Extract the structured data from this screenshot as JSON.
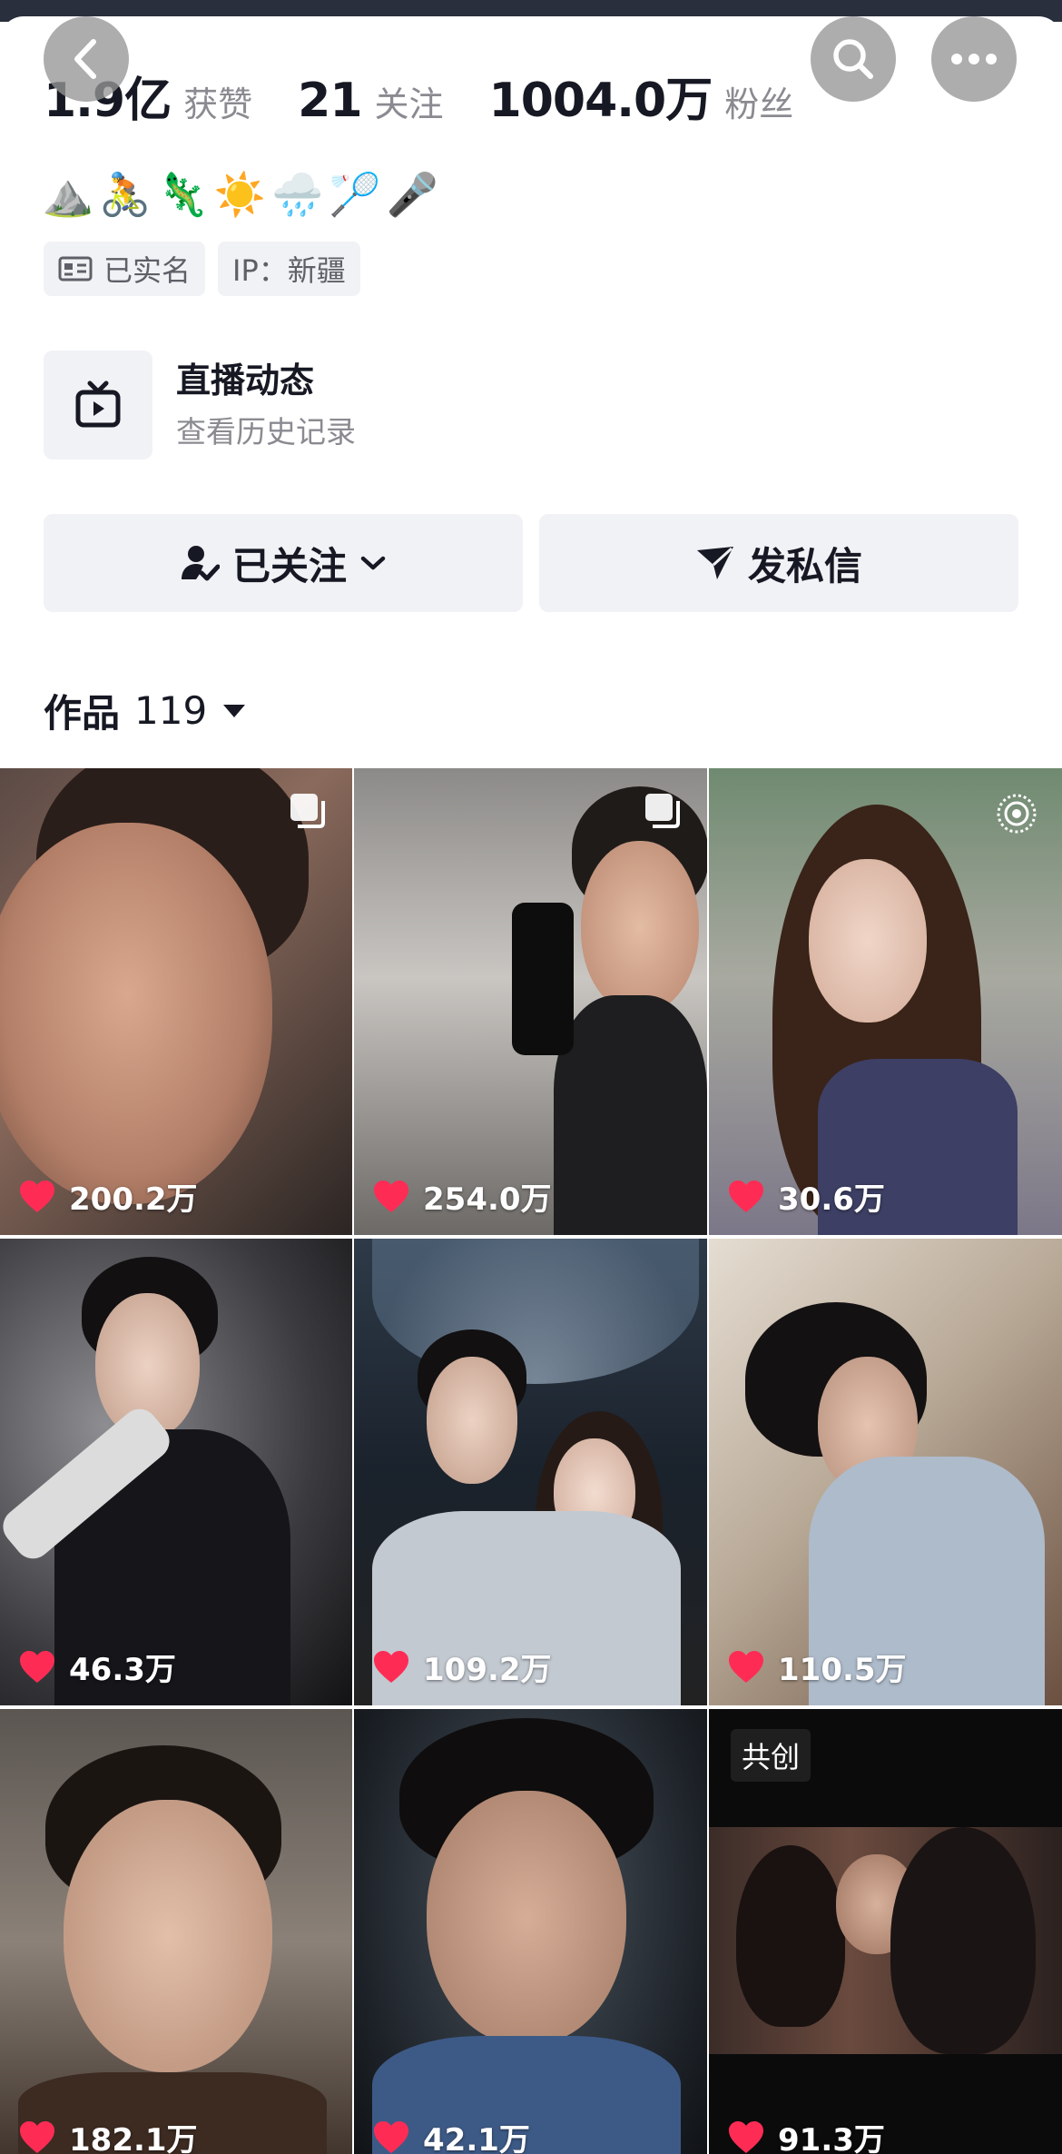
{
  "header": {
    "back_icon": "chevron-left-icon",
    "search_icon": "search-icon",
    "more_icon": "more-dots-icon"
  },
  "stats": [
    {
      "value": "1.9亿",
      "label": "获赞"
    },
    {
      "value": "21",
      "label": "关注"
    },
    {
      "value": "1004.0万",
      "label": "粉丝"
    }
  ],
  "bio_emojis": [
    "⛰️",
    "🚴",
    "🦎",
    "☀️",
    "🌧️",
    "🏸",
    "🎤"
  ],
  "tags": {
    "verified": "已实名",
    "ip": "IP：新疆"
  },
  "live": {
    "title": "直播动态",
    "subtitle": "查看历史记录"
  },
  "actions": {
    "follow_label": "已关注",
    "message_label": "发私信"
  },
  "works": {
    "label": "作品",
    "count": "119"
  },
  "videos": [
    {
      "likes": "200.2万",
      "badge": "multi-image"
    },
    {
      "likes": "254.0万",
      "badge": "multi-image"
    },
    {
      "likes": "30.6万",
      "badge": "live-photo"
    },
    {
      "likes": "46.3万",
      "badge": ""
    },
    {
      "likes": "109.2万",
      "badge": ""
    },
    {
      "likes": "110.5万",
      "badge": ""
    },
    {
      "likes": "182.1万",
      "badge": ""
    },
    {
      "likes": "42.1万",
      "badge": ""
    },
    {
      "likes": "91.3万",
      "badge": "共创"
    }
  ],
  "colors": {
    "like_heart": "#fe2c55",
    "button_bg": "#f1f2f5",
    "secondary_text": "#8a8b91"
  }
}
